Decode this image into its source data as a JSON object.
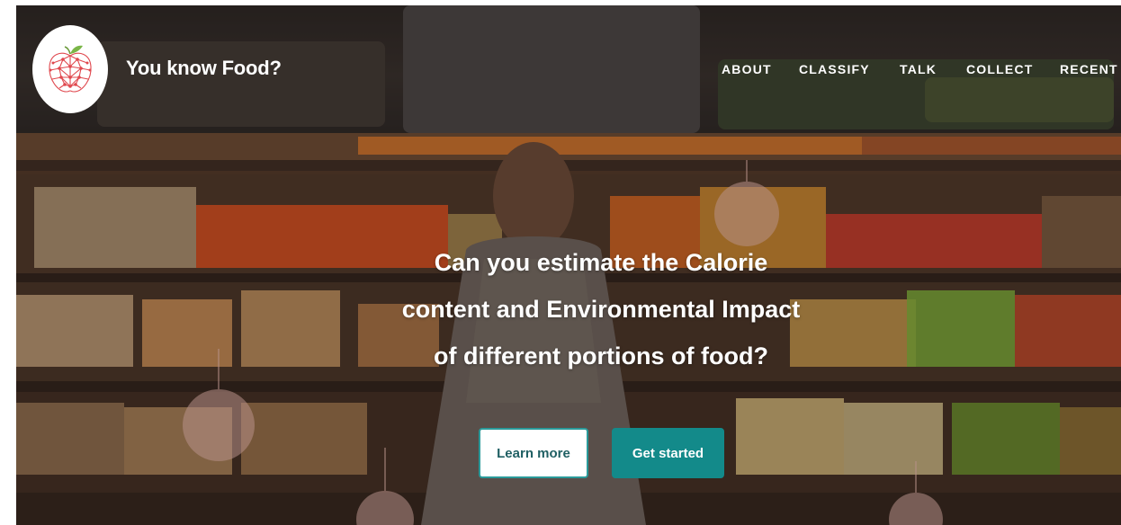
{
  "header": {
    "brand": "You know Food?",
    "logo_icon": "apple-network-icon",
    "nav": [
      {
        "label": "ABOUT"
      },
      {
        "label": "CLASSIFY"
      },
      {
        "label": "TALK"
      },
      {
        "label": "COLLECT"
      },
      {
        "label": "RECENT"
      }
    ]
  },
  "hero": {
    "headline_lines": [
      "Can you estimate the Calorie",
      "content and Environmental Impact",
      "of different portions of food?"
    ],
    "learn_more_label": "Learn more",
    "get_started_label": "Get started",
    "background_image": "supermarket-produce-aisle"
  },
  "colors": {
    "accent": "#138a8a",
    "text": "#ffffff",
    "logo_red": "#e0484e",
    "logo_leaf": "#7ab648"
  }
}
